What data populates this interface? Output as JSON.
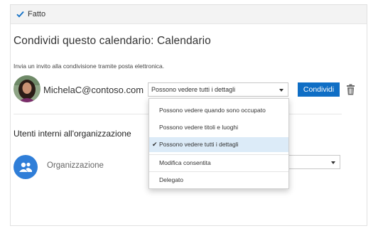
{
  "topbar": {
    "done_label": "Fatto"
  },
  "dialog": {
    "title": "Condividi questo calendario: Calendario",
    "invite_text": "Invia un invito alla condivisione tramite posta elettronica."
  },
  "invitee": {
    "email": "MichelaC@contoso.com",
    "permission": "Possono vedere tutti i dettagli",
    "share_label": "Condividi"
  },
  "permission_options": [
    "Possono vedere quando sono occupato",
    "Possono vedere titoli e luoghi",
    "Possono vedere tutti i dettagli",
    "Modifica consentita",
    "Delegato"
  ],
  "internal": {
    "section_title": "Utenti interni all'organizzazione",
    "org_label": "Organizzazione"
  },
  "colors": {
    "accent": "#0f6ec5",
    "selected_bg": "#dcebf8",
    "org_avatar": "#2f7ed8"
  }
}
